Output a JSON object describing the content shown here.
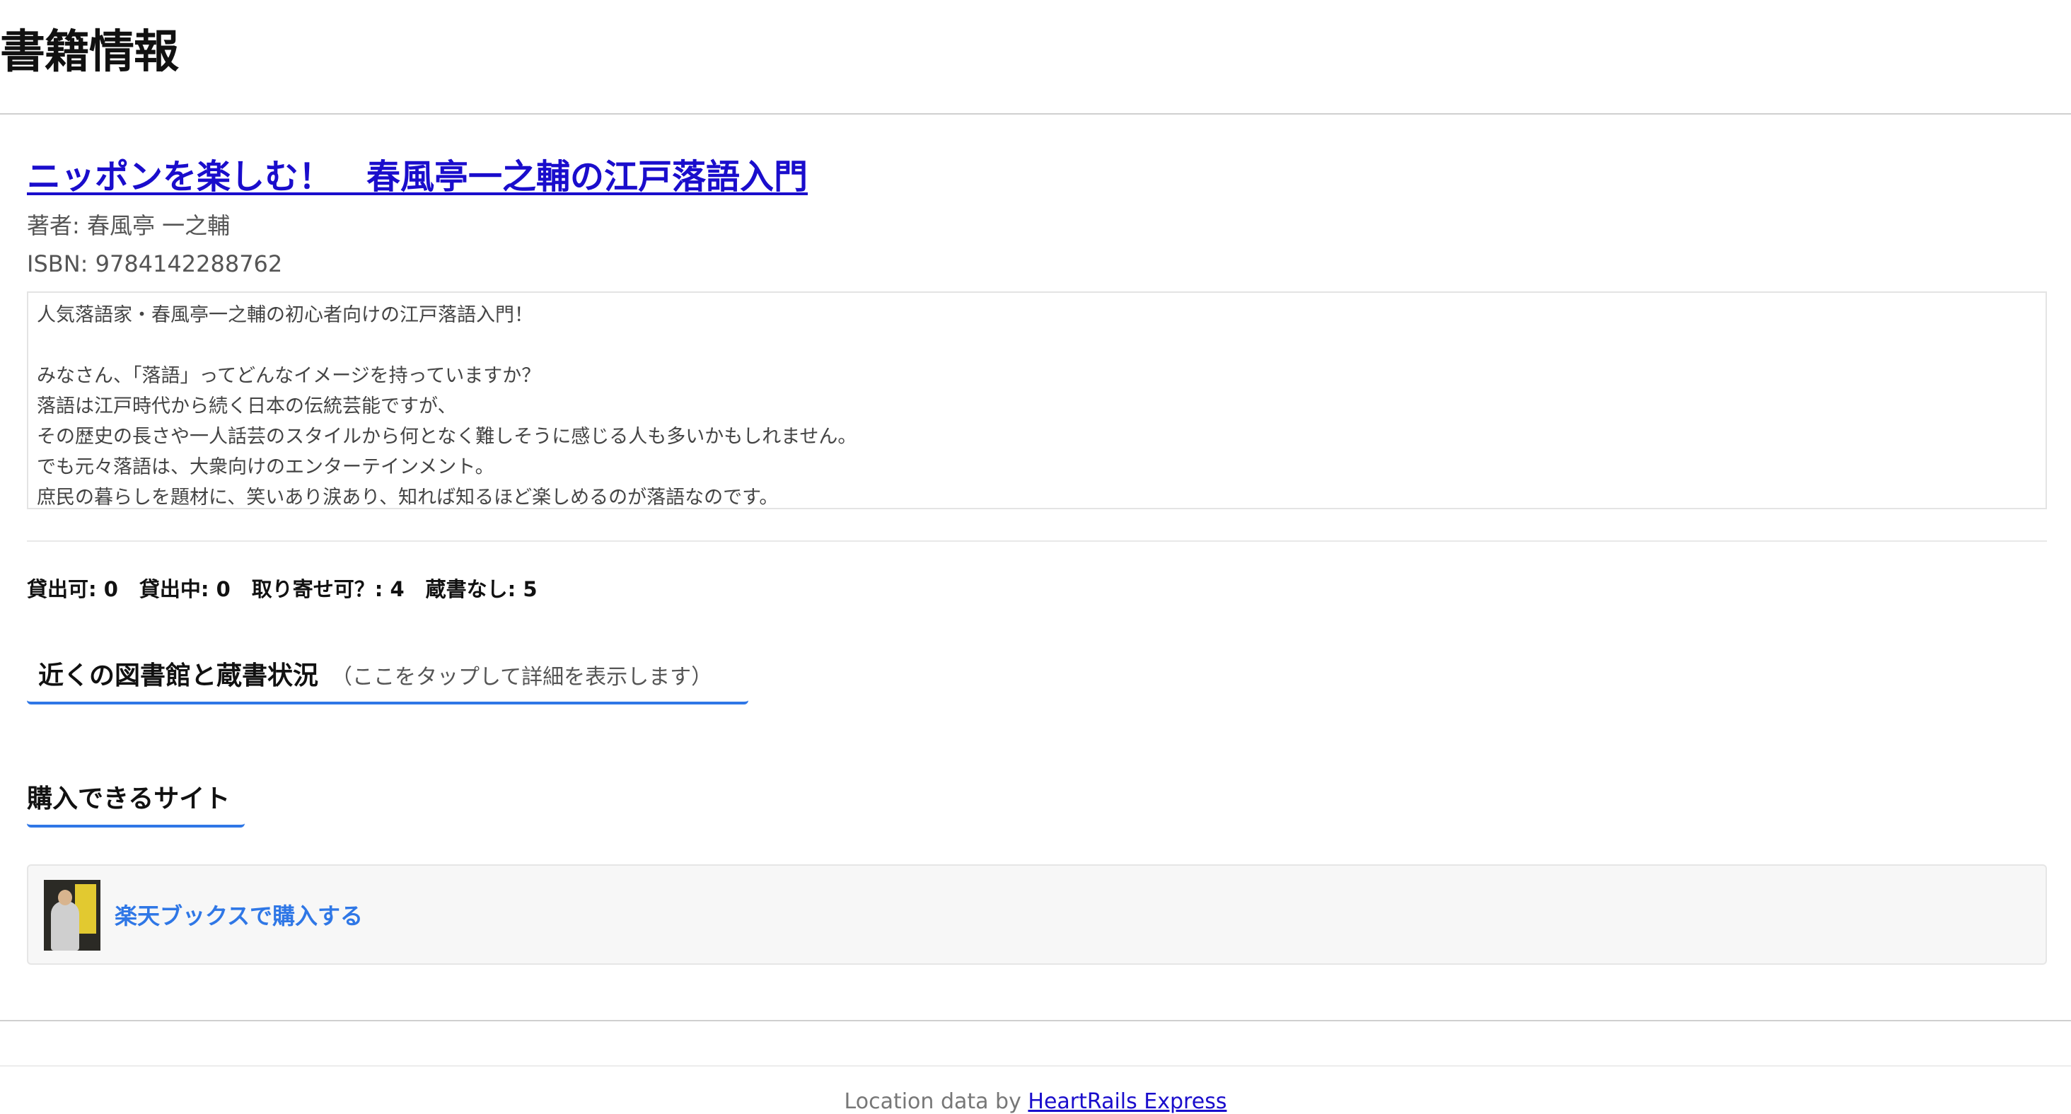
{
  "page": {
    "heading": "書籍情報"
  },
  "book": {
    "title": "ニッポンを楽しむ！　春風亭一之輔の江戸落語入門",
    "author_label": "著者: 春風亭 一之輔",
    "isbn_label": "ISBN: 9784142288762",
    "description_lines": [
      "人気落語家・春風亭一之輔の初心者向けの江戸落語入門！",
      "",
      "みなさん、「落語」ってどんなイメージを持っていますか？",
      "落語は江戸時代から続く日本の伝統芸能ですが、",
      "その歴史の長さや一人話芸のスタイルから何となく難しそうに感じる人も多いかもしれません。",
      "でも元々落語は、大衆向けのエンターテインメント。",
      "庶民の暮らしを題材に、笑いあり涙あり、知れば知るほど楽しめるのが落語なのです。"
    ]
  },
  "availability": {
    "available": "貸出可: 0",
    "on_loan": "貸出中: 0",
    "orderable": "取り寄せ可？: 4",
    "not_held": "蔵書なし: 5"
  },
  "libraries": {
    "title": "近くの図書館と蔵書状況",
    "hint": "（ここをタップして詳細を表示します）"
  },
  "purchase": {
    "title": "購入できるサイト",
    "stores": [
      {
        "label": "楽天ブックスで購入する"
      }
    ]
  },
  "footer": {
    "prefix": "Location data by ",
    "link_text": "HeartRails Express"
  },
  "colors": {
    "title_link": "#1a0dcc",
    "accent": "#2f77e6",
    "store_box_bg": "#f7f7f7"
  }
}
